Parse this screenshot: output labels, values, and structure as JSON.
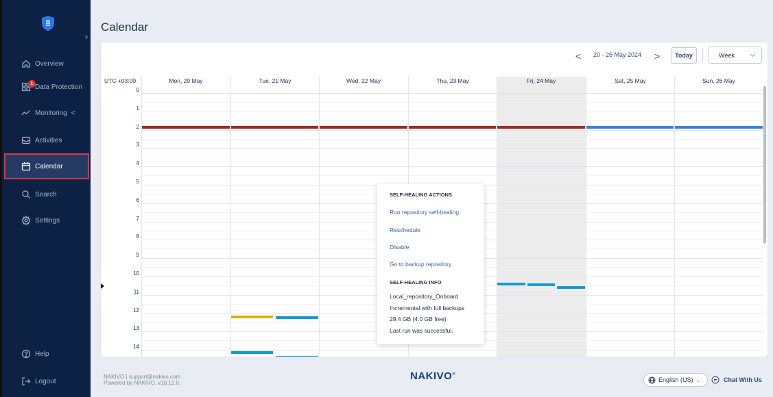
{
  "sidebar": {
    "logo_icon": "shield-logo-icon",
    "items": [
      {
        "label": "Overview",
        "icon": "home-icon"
      },
      {
        "label": "Data Protection",
        "icon": "grid-icon",
        "badge": "1"
      },
      {
        "label": "Monitoring",
        "icon": "chart-line-icon",
        "suffix": "<"
      },
      {
        "label": "Activities",
        "icon": "inbox-icon"
      },
      {
        "label": "Calendar",
        "icon": "calendar-icon",
        "active": true
      },
      {
        "label": "Search",
        "icon": "search-icon"
      },
      {
        "label": "Settings",
        "icon": "gear-icon"
      },
      {
        "label": "Help",
        "icon": "help-icon"
      },
      {
        "label": "Logout",
        "icon": "logout-icon"
      }
    ]
  },
  "page": {
    "title": "Calendar"
  },
  "toolbar": {
    "prev": "<",
    "date_range": "20 - 26 May 2024",
    "next": ">",
    "today": "Today",
    "view": "Week"
  },
  "grid": {
    "timezone": "UTC +03:00",
    "days": [
      "Mon, 20 May",
      "Tue, 21 May",
      "Wed, 22 May",
      "Thu, 23 May",
      "Fri, 24 May",
      "Sat, 25 May",
      "Sun, 26 May"
    ],
    "hours": [
      "0",
      "1",
      "2",
      "3",
      "4",
      "5",
      "6",
      "7",
      "8",
      "9",
      "10",
      "11",
      "12",
      "13",
      "14"
    ],
    "highlighted_day": "Fri, 24 May"
  },
  "colors": {
    "red_event": "#a0292a",
    "blue_event": "#3e7fd8",
    "teal_event": "#169bd0",
    "yellow_event": "#d6b20f",
    "navy_event": "#2a55a8"
  },
  "popover": {
    "actions_title": "SELF-HEALING ACTIONS",
    "actions": [
      "Run repository self-healing",
      "Reschedule",
      "Disable",
      "Go to backup repository"
    ],
    "info_title": "SELF-HEALING INFO",
    "info": [
      "Local_repository_Onboard",
      "Incremental with full backups",
      "29.4 GB (4.0 GB free)",
      "Last run was successful."
    ]
  },
  "footer": {
    "line1": "NAKIVO | support@nakivo.com",
    "line2": "Powered by NAKIVO. v10.12.0.",
    "brand": "NAKIVO",
    "language": "English (US)",
    "chat": "Chat With Us"
  }
}
